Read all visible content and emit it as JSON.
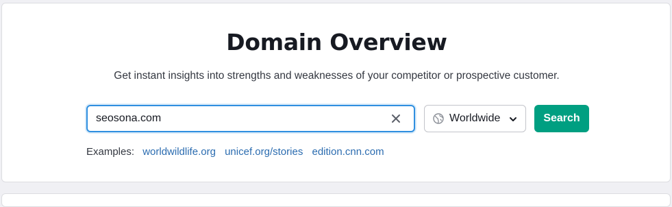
{
  "header": {
    "title": "Domain Overview",
    "subtitle": "Get instant insights into strengths and weaknesses of your competitor or prospective customer."
  },
  "search": {
    "value": "seosona.com",
    "clear_icon": "close-icon",
    "region": {
      "selected": "Worldwide",
      "icon": "globe-icon",
      "caret_icon": "chevron-down-icon"
    },
    "button_label": "Search"
  },
  "examples": {
    "label": "Examples:",
    "links": [
      "worldwildlife.org",
      "unicef.org/stories",
      "edition.cnn.com"
    ]
  },
  "colors": {
    "accent_button": "#009f81",
    "link": "#2b6cb0",
    "focus_border": "#2f8fe0"
  }
}
